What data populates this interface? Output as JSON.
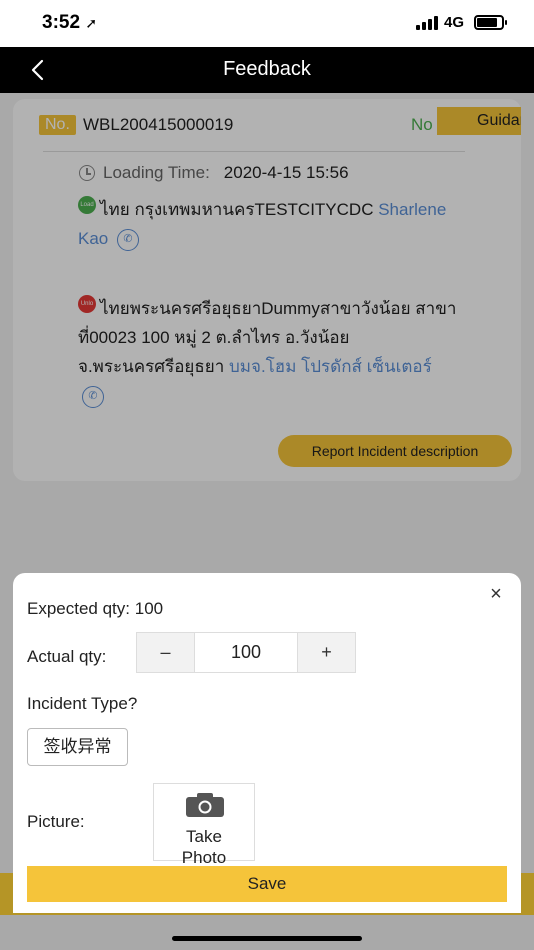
{
  "status_bar": {
    "time": "3:52",
    "location_arrow": "➚",
    "network": "4G"
  },
  "nav": {
    "title": "Feedback",
    "back_icon": "chevron-left-icon"
  },
  "order": {
    "no_label": "No.",
    "number": "WBL200415000019",
    "status": "No",
    "guide": "Guidar",
    "loading_label": "Loading Time:",
    "loading_time": "2020-4-15 15:56",
    "load_tag": "Load",
    "load_address": "ไทย กรุงเทพมหานครTESTCITYCDC",
    "load_contact": "Sharlene Kao",
    "unload_tag": "Unlo",
    "unload_address": "ไทยพระนครศรีอยุธยาDummyสาขาวังน้อย สาขาที่00023 100 หมู่ 2 ต.ลำไทร อ.วังน้อย จ.พระนครศรีอยุธยา",
    "unload_contact": "บมจ.โฮม โปรดักส์ เซ็นเตอร์",
    "report_button": "Report Incident description"
  },
  "sheet": {
    "close": "×",
    "expected_label": "Expected qty:",
    "expected_value": "100",
    "actual_label": "Actual qty:",
    "minus": "–",
    "actual_value": "100",
    "plus": "+",
    "incident_label": "Incident Type?",
    "incident_option": "签收异常",
    "picture_label": "Picture:",
    "photo_line1": "Take",
    "photo_line2": "Photo",
    "save": "Save"
  },
  "colors": {
    "accent": "#f5c43a",
    "link": "#5b8fd6",
    "status_green": "#4caf50",
    "unload_red": "#e53935"
  }
}
